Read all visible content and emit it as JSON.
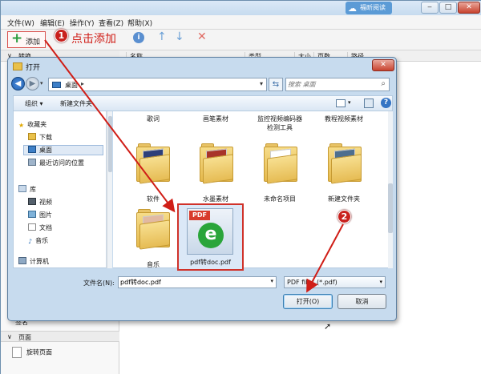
{
  "app": {
    "title_blurred": "Shjiao",
    "logo_text": "福昕阅读",
    "menu": [
      "文件(W)",
      "编辑(E)",
      "操作(Y)",
      "查看(Z)",
      "帮助(X)"
    ],
    "toolbar": {
      "add_label": "添加",
      "annotation_1": "1",
      "annotation_text": "点击添加"
    },
    "left_panel": {
      "header": "转换",
      "bottom_item": "签名",
      "page_header": "页面",
      "rotate_item": "旋转页面"
    },
    "columns": [
      "名称",
      "类型",
      "大小",
      "页数",
      "路径"
    ]
  },
  "dialog": {
    "title": "打开",
    "address": "桌面",
    "search_placeholder": "搜索 桌面",
    "commands": {
      "organize": "组织 ▾",
      "new_folder": "新建文件夹"
    },
    "nav_items": [
      {
        "label": "收藏夹",
        "icon": "star-icon"
      },
      {
        "label": "下载",
        "icon": "folder-icon"
      },
      {
        "label": "桌面",
        "icon": "desktop-icon"
      },
      {
        "label": "最近访问的位置",
        "icon": "recent-icon"
      },
      {
        "label": "库",
        "icon": "library-icon"
      },
      {
        "label": "视频",
        "icon": "video-icon"
      },
      {
        "label": "图片",
        "icon": "picture-icon"
      },
      {
        "label": "文档",
        "icon": "document-icon"
      },
      {
        "label": "音乐",
        "icon": "music-icon"
      },
      {
        "label": "计算机",
        "icon": "computer-icon"
      }
    ],
    "top_row_captions": [
      "歌词",
      "画笔素材",
      "监控视频编码器\n检测工具",
      "教程视频素材"
    ],
    "files": [
      {
        "label": "软件"
      },
      {
        "label": "水墨素材"
      },
      {
        "label": "未命名项目"
      },
      {
        "label": "新建文件夹"
      },
      {
        "label": "音乐"
      }
    ],
    "selected_file": {
      "label": "pdf转doc.pdf",
      "tag": "PDF"
    },
    "filename_label": "文件名(N):",
    "filename_value": "pdf转doc.pdf",
    "filetype": "PDF files (*.pdf)",
    "open_button": "打开(O)",
    "cancel_button": "取消",
    "annotation_2": "2"
  },
  "colors": {
    "annotation_red": "#d01e17",
    "selection_border": "#d0322a"
  }
}
